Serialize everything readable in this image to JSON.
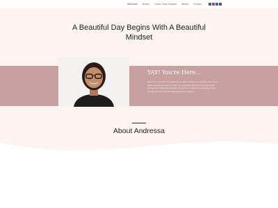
{
  "nav": {
    "items": [
      {
        "label": "Welcome",
        "active": true
      },
      {
        "label": "Books",
        "active": false
      },
      {
        "label": "Grace Club Podcast",
        "active": false
      },
      {
        "label": "Media",
        "active": false
      },
      {
        "label": "Contact",
        "active": false
      }
    ],
    "social_icons": [
      {
        "name": "facebook-icon",
        "color": "#3b5998"
      },
      {
        "name": "instagram-icon",
        "color": "#c13584"
      },
      {
        "name": "linkedin-icon",
        "color": "#0e76a8"
      },
      {
        "name": "youtube-icon",
        "color": "#555555"
      }
    ]
  },
  "hero": {
    "headline_line1": "A Beautiful Day Begins With A Beautiful",
    "headline_line2": "Mindset"
  },
  "band": {
    "title": "YAY! You're Here...",
    "body": "Welcome to my site! I'm excited you're here. I've been on a journey with a lot of highs and lows and want to share my experience with you. I'm a Grace Club podcast host, author and speaker. My goal is to inspire and encourage others through the good, the bad and everything in between."
  },
  "about": {
    "title": "About Andressa"
  },
  "colors": {
    "hero_bg": "#fdf3f0",
    "band_bg": "#c6a1a0",
    "text_dark": "#222222"
  }
}
